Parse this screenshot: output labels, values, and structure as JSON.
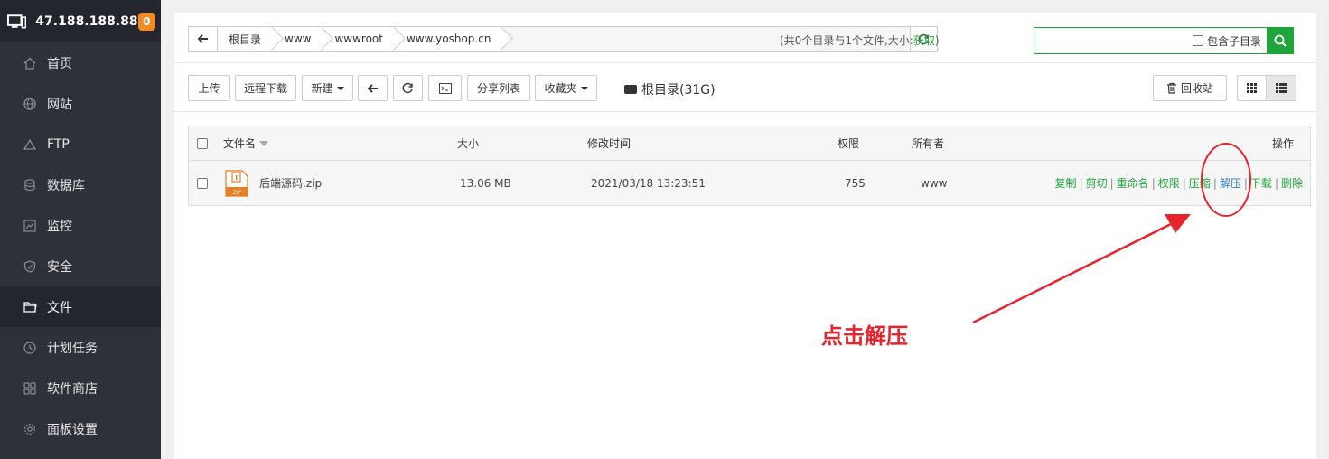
{
  "header": {
    "server_ip": "47.188.188.88",
    "badge_count": "0"
  },
  "sidebar": {
    "items": [
      {
        "label": "首页",
        "icon": "home-icon"
      },
      {
        "label": "网站",
        "icon": "globe-icon"
      },
      {
        "label": "FTP",
        "icon": "ftp-icon"
      },
      {
        "label": "数据库",
        "icon": "database-icon"
      },
      {
        "label": "监控",
        "icon": "monitor-chart-icon"
      },
      {
        "label": "安全",
        "icon": "shield-icon"
      },
      {
        "label": "文件",
        "icon": "folder-icon",
        "active": true
      },
      {
        "label": "计划任务",
        "icon": "clock-icon"
      },
      {
        "label": "软件商店",
        "icon": "grid-icon"
      },
      {
        "label": "面板设置",
        "icon": "gear-icon"
      }
    ]
  },
  "pathbar": {
    "crumbs": [
      "根目录",
      "www",
      "wwwroot",
      "www.yoshop.cn"
    ],
    "info_prefix": "(共0个目录与1个文件,大小:",
    "info_link": "获取",
    "info_suffix": ")"
  },
  "search": {
    "placeholder": "",
    "subdir_label": "包含子目录"
  },
  "toolbar": {
    "upload": "上传",
    "remote_download": "远程下载",
    "new": "新建",
    "share_list": "分享列表",
    "favorites": "收藏夹",
    "disk_label": "根目录(31G)",
    "recycle_bin": "回收站"
  },
  "table": {
    "headers": {
      "name": "文件名",
      "size": "大小",
      "mtime": "修改时间",
      "perm": "权限",
      "owner": "所有者",
      "ops": "操作"
    },
    "rows": [
      {
        "name": "后端源码.zip",
        "size": "13.06 MB",
        "mtime": "2021/03/18 13:23:51",
        "perm": "755",
        "owner": "www"
      }
    ],
    "ops": [
      "复制",
      "剪切",
      "重命名",
      "权限",
      "压缩",
      "解压",
      "下载",
      "删除"
    ]
  },
  "annotation": {
    "text": "点击解压",
    "color": "#e8232c"
  },
  "colors": {
    "accent": "#20a53a",
    "sidebar_bg": "#2f3138",
    "badge": "#f08a24"
  }
}
